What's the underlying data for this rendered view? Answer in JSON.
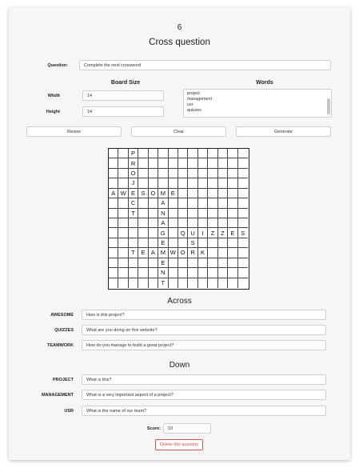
{
  "question_number": "6",
  "title": "Cross question",
  "question": {
    "label": "Question:",
    "value": "Complete the next crossword"
  },
  "board": {
    "header": "Board Size",
    "width_label": "Witdh",
    "width_value": "14",
    "height_label": "Height",
    "height_value": "14"
  },
  "words": {
    "header": "Words",
    "items": [
      "project",
      "management",
      "usr",
      "quizzes"
    ]
  },
  "buttons": {
    "resize": "Resize",
    "clear": "Clear",
    "generate": "Generate"
  },
  "grid": {
    "cols": 14,
    "rows": 14,
    "letters": [
      {
        "r": 0,
        "c": 2,
        "ch": "P"
      },
      {
        "r": 1,
        "c": 2,
        "ch": "R"
      },
      {
        "r": 2,
        "c": 2,
        "ch": "O"
      },
      {
        "r": 3,
        "c": 2,
        "ch": "J"
      },
      {
        "r": 4,
        "c": 0,
        "ch": "A"
      },
      {
        "r": 4,
        "c": 1,
        "ch": "W"
      },
      {
        "r": 4,
        "c": 2,
        "ch": "E"
      },
      {
        "r": 4,
        "c": 3,
        "ch": "S"
      },
      {
        "r": 4,
        "c": 4,
        "ch": "O"
      },
      {
        "r": 4,
        "c": 5,
        "ch": "M"
      },
      {
        "r": 4,
        "c": 6,
        "ch": "E"
      },
      {
        "r": 5,
        "c": 2,
        "ch": "C"
      },
      {
        "r": 5,
        "c": 5,
        "ch": "A"
      },
      {
        "r": 6,
        "c": 2,
        "ch": "T"
      },
      {
        "r": 6,
        "c": 5,
        "ch": "N"
      },
      {
        "r": 7,
        "c": 5,
        "ch": "A"
      },
      {
        "r": 8,
        "c": 5,
        "ch": "G"
      },
      {
        "r": 8,
        "c": 7,
        "ch": "Q"
      },
      {
        "r": 8,
        "c": 8,
        "ch": "U"
      },
      {
        "r": 8,
        "c": 9,
        "ch": "I"
      },
      {
        "r": 8,
        "c": 10,
        "ch": "Z"
      },
      {
        "r": 8,
        "c": 11,
        "ch": "Z"
      },
      {
        "r": 8,
        "c": 12,
        "ch": "E"
      },
      {
        "r": 8,
        "c": 13,
        "ch": "S"
      },
      {
        "r": 9,
        "c": 5,
        "ch": "E"
      },
      {
        "r": 9,
        "c": 8,
        "ch": "S"
      },
      {
        "r": 10,
        "c": 2,
        "ch": "T"
      },
      {
        "r": 10,
        "c": 3,
        "ch": "E"
      },
      {
        "r": 10,
        "c": 4,
        "ch": "A"
      },
      {
        "r": 10,
        "c": 5,
        "ch": "M"
      },
      {
        "r": 10,
        "c": 6,
        "ch": "W"
      },
      {
        "r": 10,
        "c": 7,
        "ch": "O"
      },
      {
        "r": 10,
        "c": 8,
        "ch": "R"
      },
      {
        "r": 10,
        "c": 9,
        "ch": "K"
      },
      {
        "r": 11,
        "c": 5,
        "ch": "E"
      },
      {
        "r": 12,
        "c": 5,
        "ch": "N"
      },
      {
        "r": 13,
        "c": 5,
        "ch": "T"
      }
    ]
  },
  "across": {
    "header": "Across",
    "clues": [
      {
        "word": "AWESOME",
        "clue": "How is this project?"
      },
      {
        "word": "QUIZZES",
        "clue": "What are you doing on this website?"
      },
      {
        "word": "TEAMWORK",
        "clue": "How do you manage to build a great project?"
      }
    ]
  },
  "down": {
    "header": "Down",
    "clues": [
      {
        "word": "PROJECT",
        "clue": "What is this?"
      },
      {
        "word": "MANAGEMENT",
        "clue": "What is a very important aspect of a project?"
      },
      {
        "word": "USR",
        "clue": "What is the name of our team?"
      }
    ]
  },
  "score": {
    "label": "Score:",
    "value": "10"
  },
  "delete_label": "Delete this question"
}
